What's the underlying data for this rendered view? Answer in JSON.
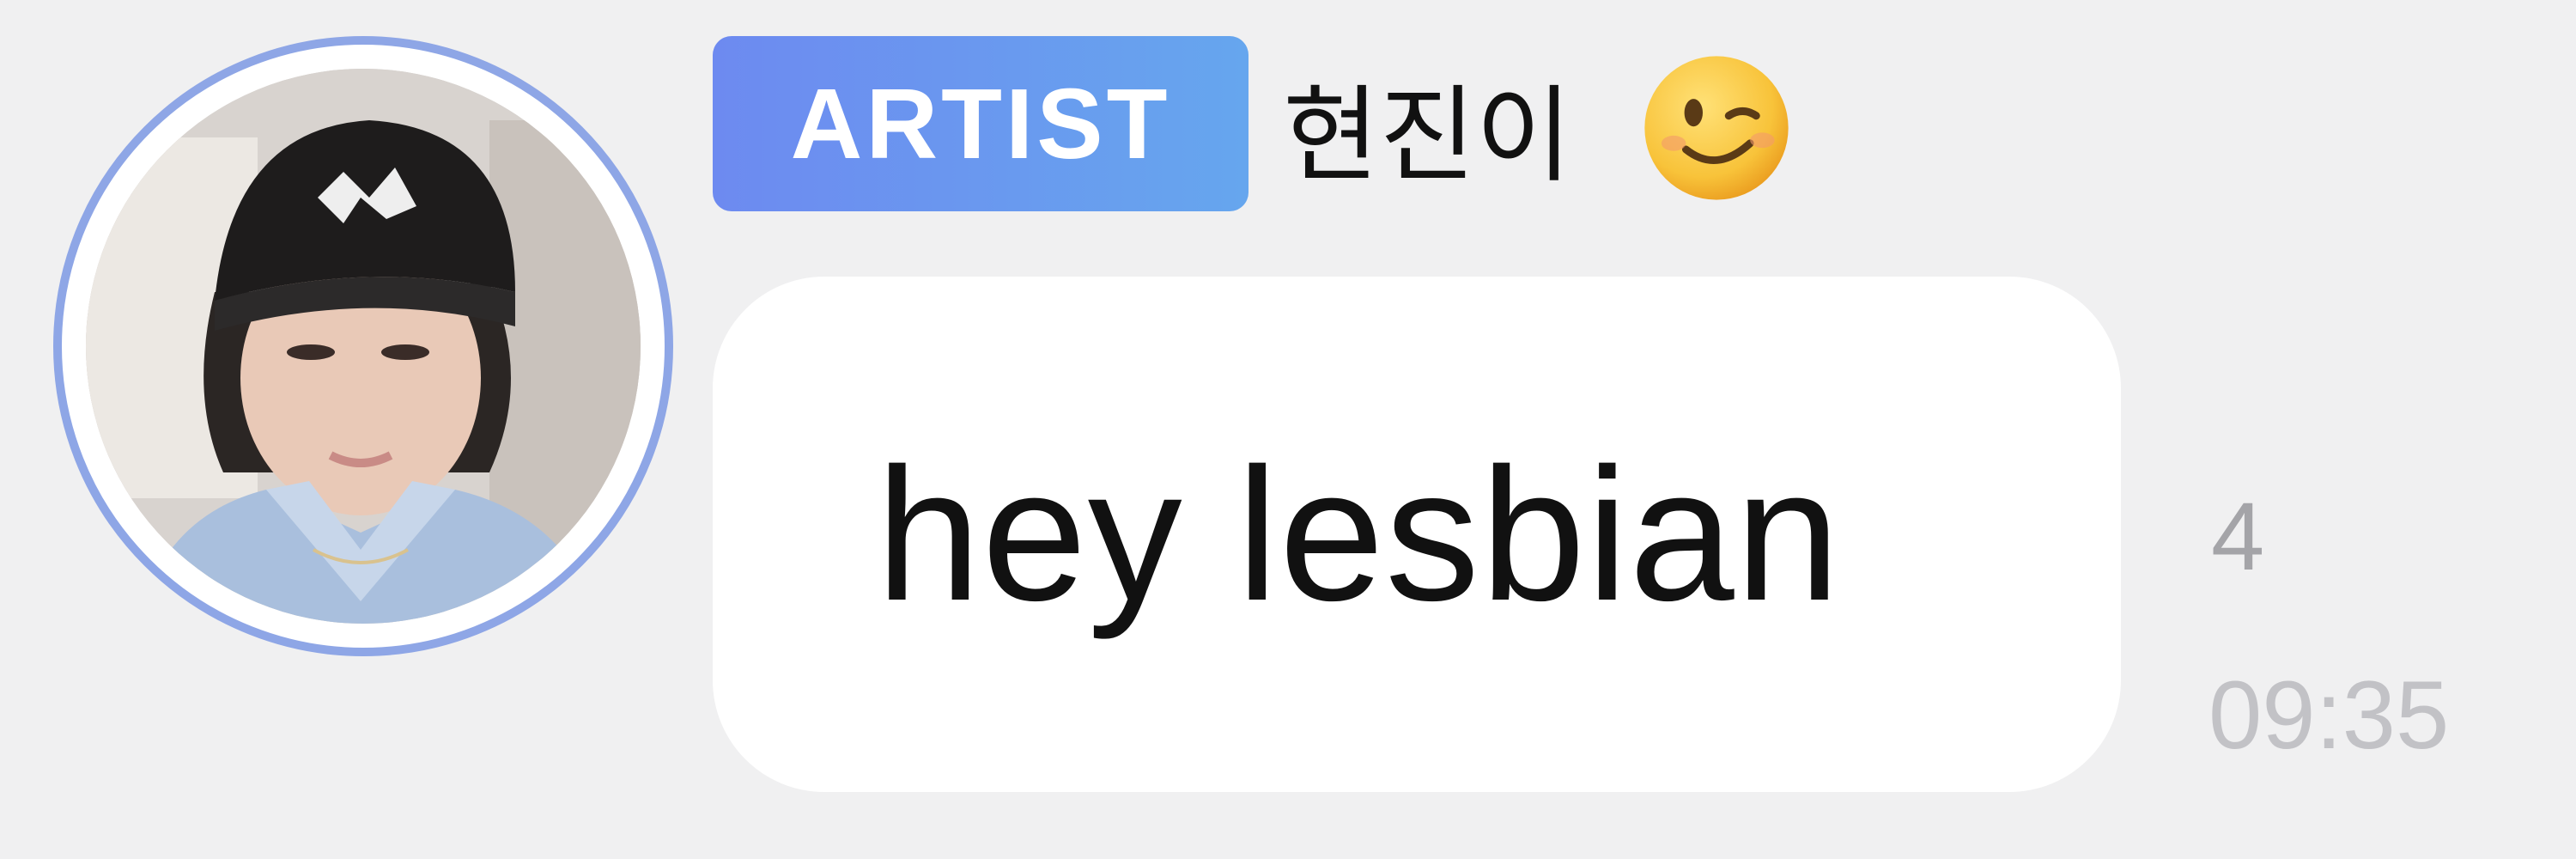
{
  "message": {
    "sender": {
      "badge_label": "ARTIST",
      "name": "현진이",
      "name_emoji_icon": "winking-face-icon",
      "avatar_icon": "profile-photo-avatar"
    },
    "text": "hey lesbian",
    "unread_count": "4",
    "time": "09:35"
  },
  "colors": {
    "background": "#f0f0f1",
    "badge_start": "#6d8af0",
    "badge_end": "#66a6ee",
    "avatar_ring": "#8ea6e6",
    "bubble": "#ffffff",
    "meta_text": "#a4a4a8"
  }
}
